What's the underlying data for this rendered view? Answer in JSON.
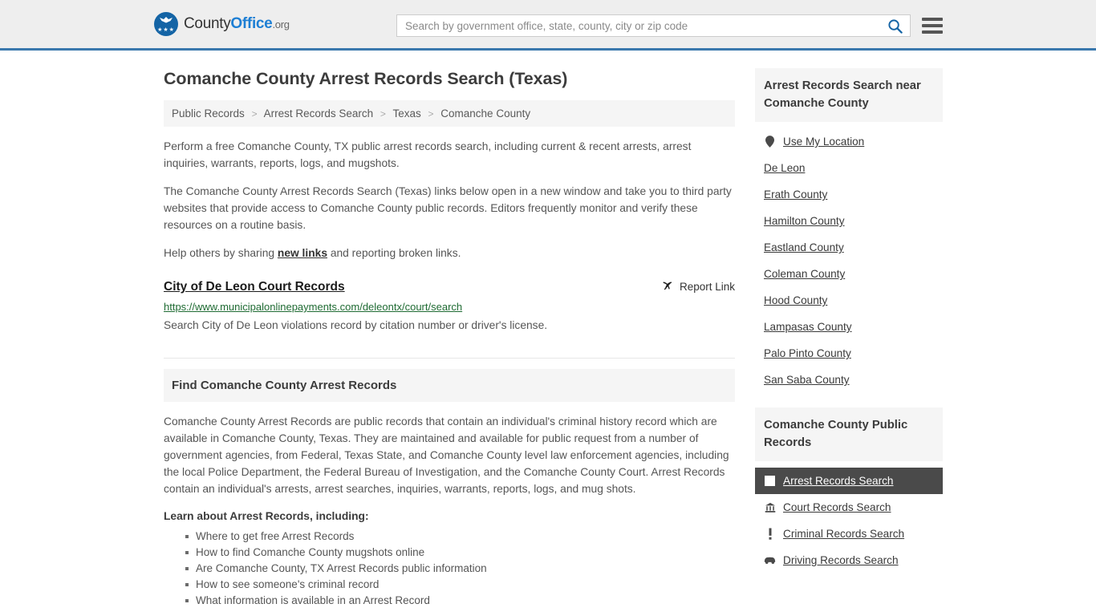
{
  "header": {
    "logo": {
      "name_part1": "County",
      "name_part2": "Office",
      "tld": ".org",
      "icon": "eagle-shield-icon"
    },
    "search": {
      "placeholder": "Search by government office, state, county, city or zip code",
      "value": "",
      "icon": "search-icon",
      "accent_color": "#1464a5"
    },
    "menu": {
      "icon": "hamburger-menu-icon",
      "label": "Menu"
    },
    "border_color": "#3a78ad"
  },
  "main": {
    "title": "Comanche County Arrest Records Search (Texas)",
    "breadcrumb": [
      "Public Records",
      "Arrest Records Search",
      "Texas",
      "Comanche County"
    ],
    "breadcrumb_separator": ">",
    "intro_paragraph_1": "Perform a free Comanche County, TX public arrest records search, including current & recent arrests, arrest inquiries, warrants, reports, logs, and mugshots.",
    "intro_paragraph_2": "The Comanche County Arrest Records Search (Texas) links below open in a new window and take you to third party websites that provide access to Comanche County public records. Editors frequently monitor and verify these resources on a routine basis.",
    "help_text_before": "Help others by sharing ",
    "help_link": "new links",
    "help_text_after": " and reporting broken links.",
    "result": {
      "title": "City of De Leon Court Records",
      "url": "https://www.municipalonlinepayments.com/deleontx/court/search",
      "description": "Search City of De Leon violations record by citation number or driver's license.",
      "report_label": "Report Link",
      "report_icon": "broken-link-icon"
    },
    "section": {
      "heading": "Find Comanche County Arrest Records",
      "paragraph": "Comanche County Arrest Records are public records that contain an individual's criminal history record which are available in Comanche County, Texas. They are maintained and available for public request from a number of government agencies, from Federal, Texas State, and Comanche County level law enforcement agencies, including the local Police Department, the Federal Bureau of Investigation, and the Comanche County Court. Arrest Records contain an individual's arrests, arrest searches, inquiries, warrants, reports, logs, and mug shots.",
      "learn_title": "Learn about Arrest Records, including:",
      "learn_items": [
        "Where to get free Arrest Records",
        "How to find Comanche County mugshots online",
        "Are Comanche County, TX Arrest Records public information",
        "How to see someone's criminal record",
        "What information is available in an Arrest Record"
      ]
    }
  },
  "sidebar": {
    "nearby": {
      "heading": "Arrest Records Search near Comanche County",
      "items": [
        {
          "label": "Use My Location",
          "icon": "map-pin-icon"
        },
        {
          "label": "De Leon",
          "icon": "none"
        },
        {
          "label": "Erath County",
          "icon": "none"
        },
        {
          "label": "Hamilton County",
          "icon": "none"
        },
        {
          "label": "Eastland County",
          "icon": "none"
        },
        {
          "label": "Coleman County",
          "icon": "none"
        },
        {
          "label": "Hood County",
          "icon": "none"
        },
        {
          "label": "Lampasas County",
          "icon": "none"
        },
        {
          "label": "Palo Pinto County",
          "icon": "none"
        },
        {
          "label": "San Saba County",
          "icon": "none"
        }
      ]
    },
    "public_records": {
      "heading": "Comanche County Public Records",
      "active_background": "#4a4a4a",
      "items": [
        {
          "label": "Arrest Records Search",
          "icon": "square-badge-icon",
          "active": true
        },
        {
          "label": "Court Records Search",
          "icon": "courthouse-icon",
          "active": false
        },
        {
          "label": "Criminal Records Search",
          "icon": "exclamation-icon",
          "active": false
        },
        {
          "label": "Driving Records Search",
          "icon": "car-icon",
          "active": false
        }
      ]
    }
  }
}
